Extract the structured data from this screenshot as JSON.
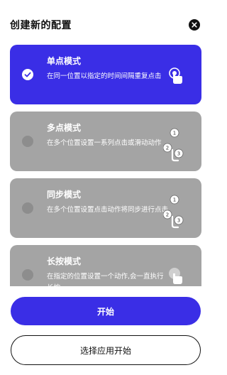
{
  "header": {
    "title": "创建新的配置"
  },
  "modes": [
    {
      "name": "单点模式",
      "description": "在同一位置以指定的时间间隔重复点击",
      "selected": true,
      "icon": "single-tap-icon"
    },
    {
      "name": "多点模式",
      "description": "在多个位置设置一系列点击或滑动动作",
      "selected": false,
      "icon": "multi-tap-icon"
    },
    {
      "name": "同步模式",
      "description": "在多个位置设置点击动作将同步进行点击",
      "selected": false,
      "icon": "sync-tap-icon"
    },
    {
      "name": "长按模式",
      "description": "在指定的位置设置一个动作,会一直执行长按",
      "selected": false,
      "icon": "long-press-icon"
    }
  ],
  "actions": {
    "start_label": "开始",
    "choose_app_label": "选择应用开始"
  },
  "colors": {
    "accent": "#3a2ee6",
    "card_inactive": "#a4a4a4",
    "radio_inactive": "#8d8d8d"
  }
}
